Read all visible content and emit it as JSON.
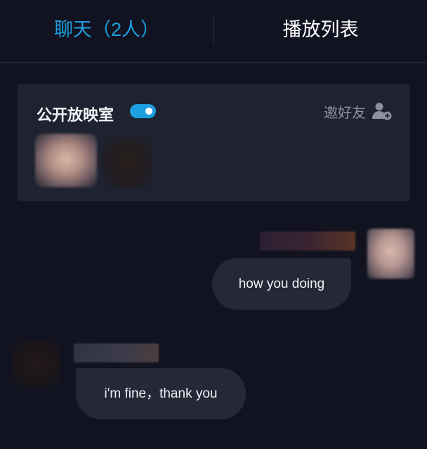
{
  "tabs": {
    "chat_label": "聊天（2人）",
    "playlist_label": "播放列表",
    "active_color": "#1e9fe0"
  },
  "room": {
    "title": "公开放映室",
    "public_toggle_on": true,
    "invite_label": "邀好友",
    "invite_icon": "add-user-icon"
  },
  "messages": [
    {
      "side": "right",
      "text": "how you doing"
    },
    {
      "side": "left",
      "text": "i'm fine，thank you"
    }
  ],
  "colors": {
    "background": "#111321",
    "card": "#1f2230",
    "bubble": "#252836",
    "accent": "#1e9fe0"
  }
}
